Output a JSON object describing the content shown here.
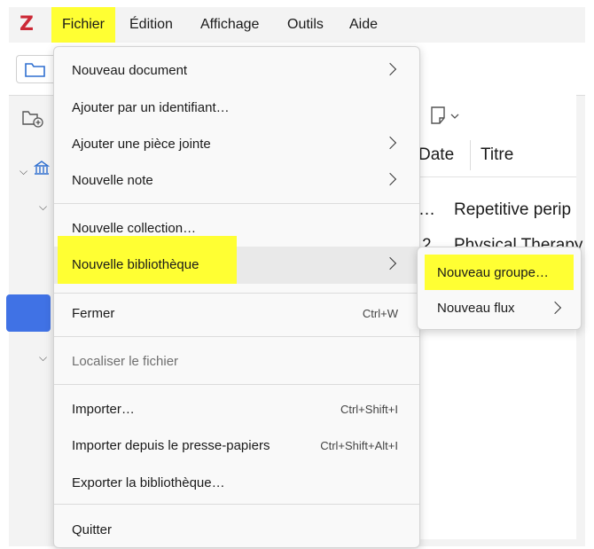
{
  "menubar": {
    "logo": "Z",
    "items": [
      {
        "label": "Fichier"
      },
      {
        "label": "Édition"
      },
      {
        "label": "Affichage"
      },
      {
        "label": "Outils"
      },
      {
        "label": "Aide"
      }
    ]
  },
  "background": {
    "columns": {
      "date": "Date",
      "title": "Titre"
    },
    "rows": [
      {
        "date": "…",
        "title": "Repetitive perip"
      },
      {
        "date": "2",
        "title": "Physical Therapy"
      }
    ]
  },
  "file_menu": {
    "items": [
      {
        "label": "Nouveau document",
        "submenu": true
      },
      {
        "label": "Ajouter par un identifiant…"
      },
      {
        "label": "Ajouter une pièce jointe",
        "submenu": true
      },
      {
        "label": "Nouvelle note",
        "submenu": true
      },
      {
        "label": "Nouvelle collection…"
      },
      {
        "label": "Nouvelle bibliothèque",
        "submenu": true
      },
      {
        "label": "Fermer",
        "shortcut": "Ctrl+W"
      },
      {
        "label": "Localiser le fichier",
        "disabled": true
      },
      {
        "label": "Importer…",
        "shortcut": "Ctrl+Shift+I"
      },
      {
        "label": "Importer depuis le presse-papiers",
        "shortcut": "Ctrl+Shift+Alt+I"
      },
      {
        "label": "Exporter la bibliothèque…"
      },
      {
        "label": "Quitter"
      }
    ]
  },
  "library_submenu": {
    "items": [
      {
        "label": "Nouveau groupe…"
      },
      {
        "label": "Nouveau flux",
        "submenu": true
      }
    ]
  },
  "colors": {
    "highlight": "#ffff33",
    "accent_blue": "#4072e5",
    "logo_red": "#cc2936"
  }
}
